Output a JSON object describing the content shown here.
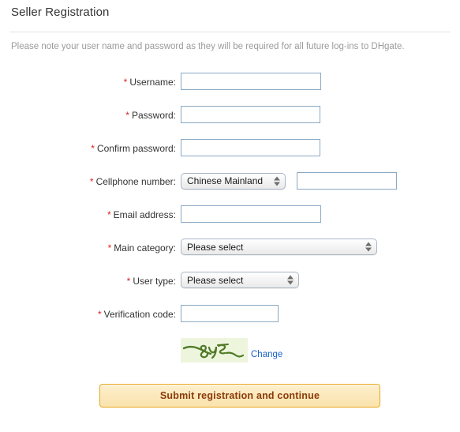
{
  "header": {
    "title": "Seller Registration",
    "notice": "Please note your user name and password as they will be required for all future log-ins to DHgate."
  },
  "colors": {
    "required_asterisk": "#e01f1f",
    "input_border": "#8aa9c4",
    "link": "#1a62c4",
    "button_border": "#e8a820",
    "button_text": "#8a3a0a",
    "captcha_background": "#eef5dd",
    "captcha_ink": "#4f7a27",
    "notice_text": "#9b9b9b"
  },
  "form": {
    "required_marker": "*",
    "rows": [
      {
        "label": "Username:",
        "value": "",
        "placeholder": ""
      },
      {
        "label": "Password:",
        "value": "",
        "placeholder": ""
      },
      {
        "label": "Confirm password:",
        "value": "",
        "placeholder": ""
      },
      {
        "label": "Cellphone number:",
        "value": "",
        "placeholder": ""
      },
      {
        "label": "Email address:",
        "value": "",
        "placeholder": ""
      },
      {
        "label": "Main category:",
        "value": "",
        "placeholder": ""
      },
      {
        "label": "User type:",
        "value": "",
        "placeholder": ""
      },
      {
        "label": "Verification code:",
        "value": "",
        "placeholder": ""
      }
    ],
    "country_select": {
      "selected": "Chinese Mainland",
      "options": [
        "Chinese Mainland"
      ]
    },
    "category_select": {
      "selected": "Please select",
      "options": [
        "Please select"
      ]
    },
    "usertype_select": {
      "selected": "Please select",
      "options": [
        "Please select"
      ]
    }
  },
  "captcha": {
    "code_text": "8y3r",
    "change_label": "Change"
  },
  "submit": {
    "label": "Submit registration and continue"
  }
}
